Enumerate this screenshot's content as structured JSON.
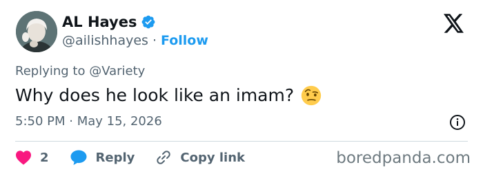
{
  "author": {
    "display_name": "AL Hayes",
    "handle": "@ailishhayes",
    "separator": "·",
    "follow_label": "Follow"
  },
  "tweet": {
    "replying_to": "Replying to @Variety",
    "text": "Why does he look like an imam?",
    "emoji": "face-with-raised-eyebrow",
    "timestamp": "5:50 PM · May 15, 2026"
  },
  "actions": {
    "like_count": "2",
    "reply_label": "Reply",
    "copy_link_label": "Copy link"
  },
  "watermark": "boredpanda.com",
  "colors": {
    "accent": "#1d9bf0",
    "like": "#f91880",
    "text": "#0f1419",
    "muted": "#536471"
  }
}
